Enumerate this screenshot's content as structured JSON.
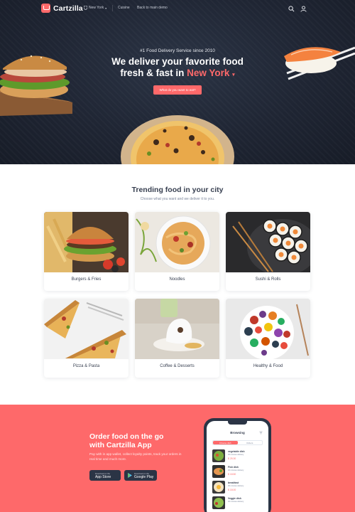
{
  "colors": {
    "accent": "#fe696a",
    "dark": "#1f2533",
    "text": "#373f50",
    "muted": "#7d879c"
  },
  "navbar": {
    "brand": "Cartzilla",
    "location": "New York",
    "links": [
      "Cuisine",
      "Back to main demo"
    ],
    "icons": [
      "search-icon",
      "user-icon"
    ]
  },
  "hero": {
    "subtitle": "#1 Food Delivery Service since 2010",
    "title_line1": "We deliver your favorite food",
    "title_line2": "fresh & fast in",
    "title_city": "New York",
    "cta": "What do you want to eat?"
  },
  "trending": {
    "title": "Trending food in your city",
    "subtitle": "Choose what you want and we deliver it to you.",
    "categories": [
      {
        "label": "Burgers & Fries"
      },
      {
        "label": "Noodles"
      },
      {
        "label": "Sushi & Rolls"
      },
      {
        "label": "Pizza & Pasta"
      },
      {
        "label": "Coffee & Desserts"
      },
      {
        "label": "Healthy & Food"
      }
    ]
  },
  "promo": {
    "title_line1": "Order food on the go",
    "title_line2": "with Cartzilla App",
    "text": "Pay with in app wallet, collect loyalty points, track your orders in real time and much more.",
    "app_store_small": "Download on the",
    "app_store": "App Store",
    "google_play_small": "Download on the",
    "google_play": "Google Play"
  },
  "phone": {
    "header": "Browsing",
    "tabs": [
      "Choose dish",
      "Orders"
    ],
    "dishes": [
      {
        "name": "vegetable dish",
        "meta": "30 minutes delivery",
        "price": "$ 25.30"
      },
      {
        "name": "Fish dish",
        "meta": "30 minutes delivery",
        "price": "$ 18.50"
      },
      {
        "name": "breakfast",
        "meta": "30 minutes delivery",
        "price": "$ 18.00"
      },
      {
        "name": "Veggie dish",
        "meta": "30 minutes delivery",
        "price": ""
      }
    ]
  }
}
